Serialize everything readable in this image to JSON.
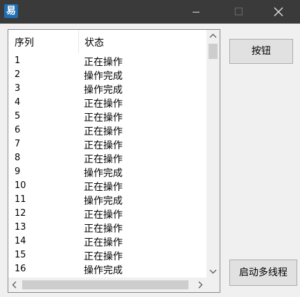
{
  "window": {
    "icon_glyph": "易",
    "minimize_icon": "minimize-icon",
    "maximize_icon": "maximize-icon",
    "close_icon": "close-icon"
  },
  "listview": {
    "columns": [
      "序列",
      "状态"
    ],
    "rows": [
      [
        "1",
        "正在操作"
      ],
      [
        "2",
        "操作完成"
      ],
      [
        "3",
        "操作完成"
      ],
      [
        "4",
        "正在操作"
      ],
      [
        "5",
        "正在操作"
      ],
      [
        "6",
        "正在操作"
      ],
      [
        "7",
        "正在操作"
      ],
      [
        "8",
        "正在操作"
      ],
      [
        "9",
        "操作完成"
      ],
      [
        "10",
        "正在操作"
      ],
      [
        "11",
        "操作完成"
      ],
      [
        "12",
        "正在操作"
      ],
      [
        "13",
        "正在操作"
      ],
      [
        "14",
        "正在操作"
      ],
      [
        "15",
        "正在操作"
      ],
      [
        "16",
        "操作完成"
      ]
    ]
  },
  "buttons": {
    "main_label": "按钮",
    "start_label": "启动多线程"
  }
}
